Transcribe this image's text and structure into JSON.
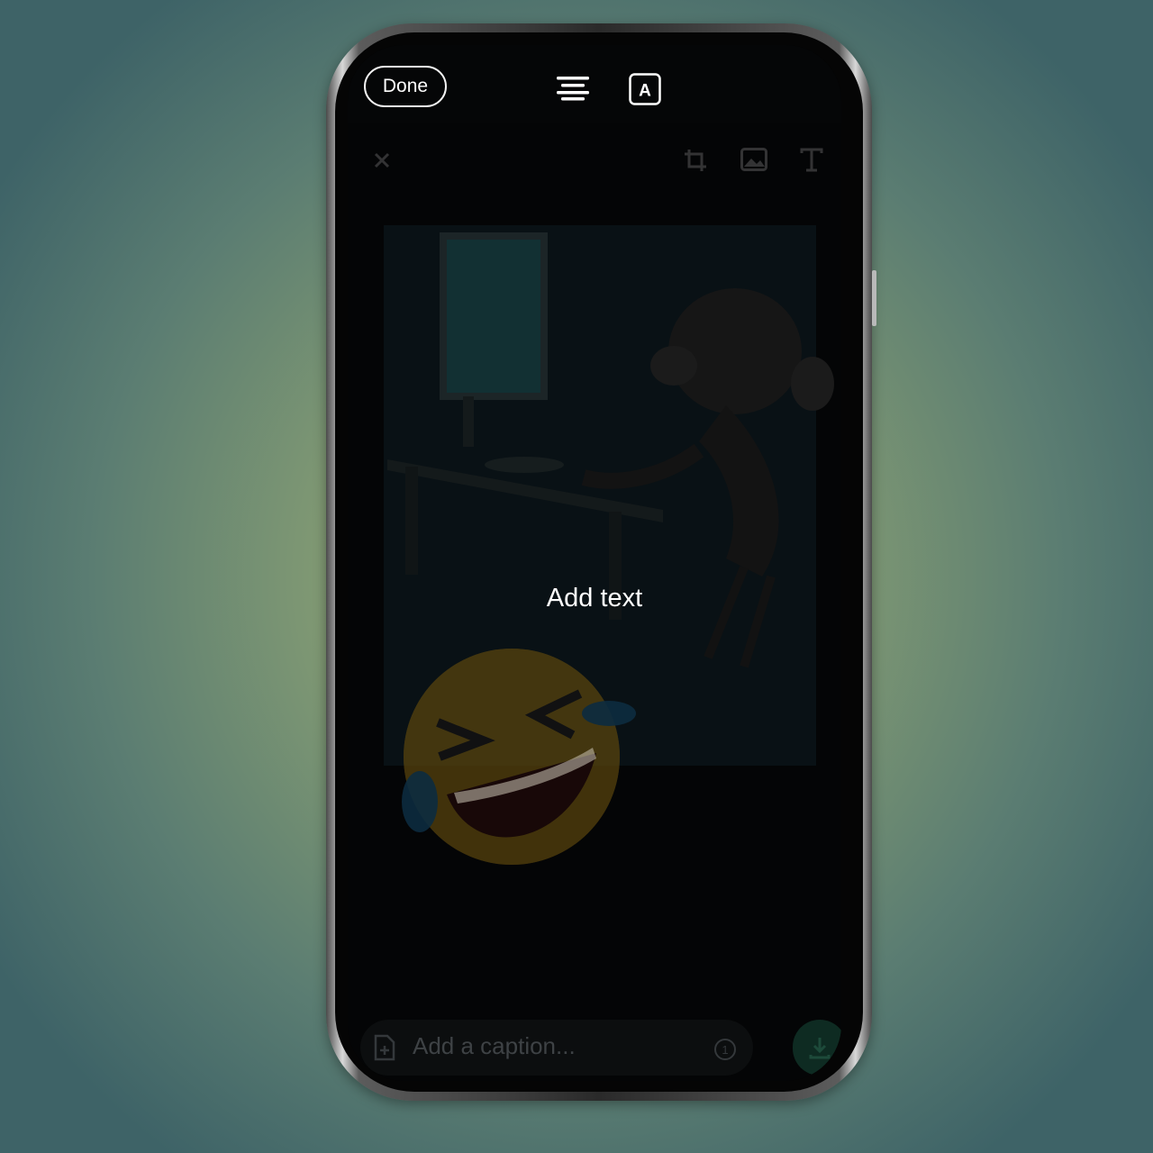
{
  "top_bar": {
    "done_label": "Done",
    "align_icon": "align-center-icon",
    "font_style_icon": "text-style-icon",
    "font_style_glyph": "A"
  },
  "editor_toolbar": {
    "close_icon": "close-icon",
    "crop_icon": "crop-icon",
    "sticker_icon": "image-icon",
    "text_icon": "text-tool-icon"
  },
  "canvas": {
    "text_prompt": "Add text",
    "background": "dimmed cartoon image with laughing emoji"
  },
  "caption": {
    "placeholder": "Add a caption...",
    "add_media_icon": "add-file-icon",
    "view_once_icon": "view-once-icon",
    "view_once_glyph": "1"
  },
  "send": {
    "icon": "download-icon"
  },
  "colors": {
    "background_center": "#8fa377",
    "background_edge": "#3e6367",
    "screen": "#040506",
    "send_button": "#0e2b22",
    "emoji": "#b28a1e"
  }
}
